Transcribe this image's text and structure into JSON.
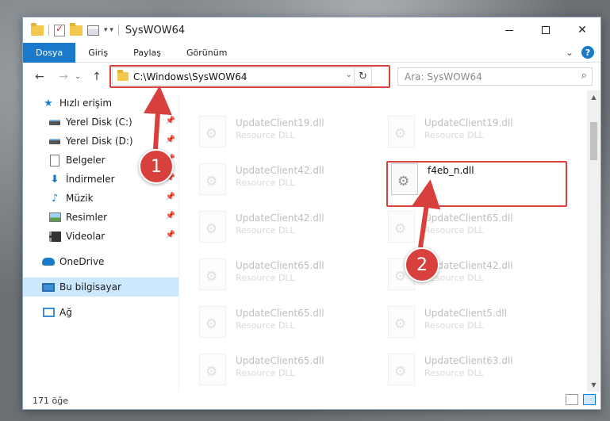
{
  "window": {
    "title": "SysWOW64",
    "quick_access_more": "▾ ▾"
  },
  "ribbon": {
    "tabs": [
      "Dosya",
      "Giriş",
      "Paylaş",
      "Görünüm"
    ],
    "expand_glyph": "⌄",
    "help": "?"
  },
  "address": {
    "path": "C:\\Windows\\SysWOW64",
    "dropdown": "⌄",
    "refresh": "↻"
  },
  "search": {
    "placeholder": "Ara: SysWOW64"
  },
  "nav": {
    "items": [
      {
        "label": "Hızlı erişim",
        "icon": "quick-access-star-icon"
      },
      {
        "label": "Yerel Disk (C:)",
        "icon": "drive-icon",
        "pinned": true
      },
      {
        "label": "Yerel Disk (D:)",
        "icon": "drive-icon",
        "pinned": true
      },
      {
        "label": "Belgeler",
        "icon": "documents-icon",
        "pinned": true
      },
      {
        "label": "İndirmeler",
        "icon": "downloads-icon",
        "pinned": true
      },
      {
        "label": "Müzik",
        "icon": "music-icon",
        "pinned": true
      },
      {
        "label": "Resimler",
        "icon": "pictures-icon",
        "pinned": true
      },
      {
        "label": "Videolar",
        "icon": "videos-icon",
        "pinned": true
      },
      {
        "label": "OneDrive",
        "icon": "onedrive-icon"
      },
      {
        "label": "Bu bilgisayar",
        "icon": "this-pc-icon",
        "selected": true
      },
      {
        "label": "Ağ",
        "icon": "network-icon"
      }
    ]
  },
  "files": {
    "left_column": [
      {
        "name": "UpdateClient19.dll",
        "type": "Resource DLL"
      },
      {
        "name": "UpdateClient42.dll",
        "type": "Resource DLL"
      },
      {
        "name": "UpdateClient42.dll",
        "type": "Resource DLL"
      },
      {
        "name": "UpdateClient65.dll",
        "type": "Resource DLL"
      },
      {
        "name": "UpdateClient65.dll",
        "type": "Resource DLL"
      },
      {
        "name": "UpdateClient65.dll",
        "type": "Resource DLL"
      }
    ],
    "right_column": [
      {
        "name": "UpdateClient19.dll",
        "type": "Resource DLL"
      },
      {
        "name": "UpdateClient65.dll",
        "type": "Resource DLL"
      },
      {
        "name": "UpdateClient42.dll",
        "type": "Resource DLL"
      },
      {
        "name": "UpdateClient5.dll",
        "type": "Resource DLL"
      },
      {
        "name": "UpdateClient63.dll",
        "type": "Resource DLL"
      }
    ],
    "highlighted": {
      "name": "f4eb_n.dll"
    }
  },
  "status": {
    "count": "171 öğe"
  },
  "annotations": {
    "badge1": "1",
    "badge2": "2",
    "color": "#d8403e"
  }
}
